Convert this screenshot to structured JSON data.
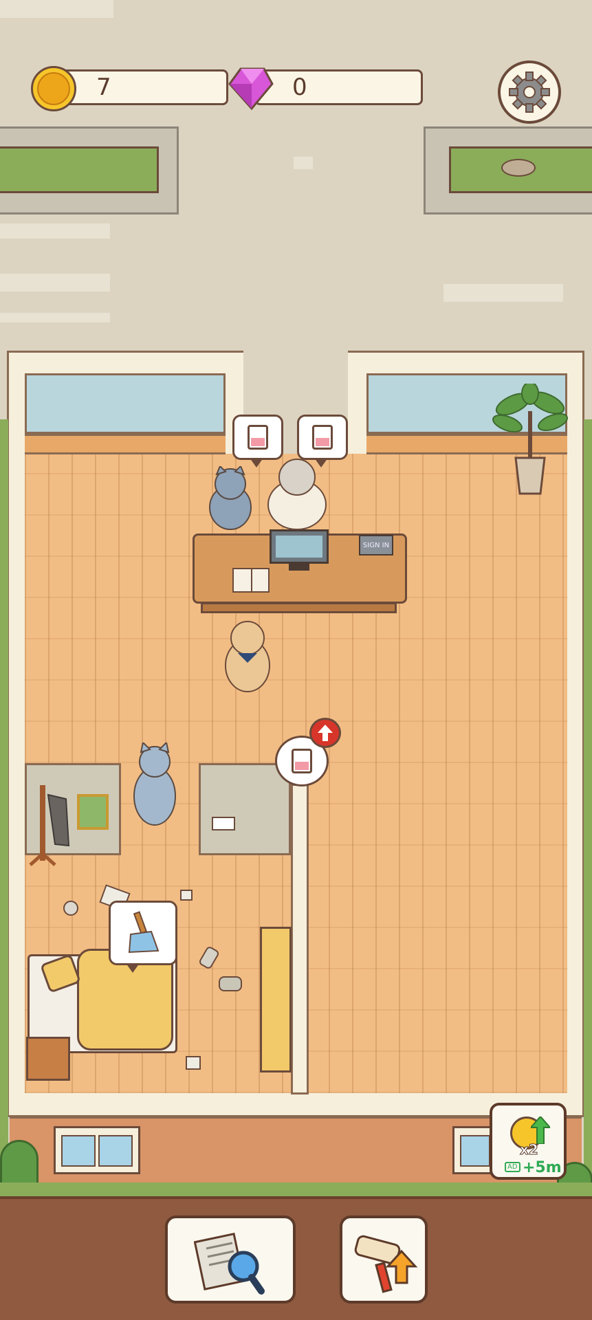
{
  "hud": {
    "coins": "7",
    "gems": "0"
  },
  "reception": {
    "sign": "SIGN IN"
  },
  "boost": {
    "multiplier": "x2",
    "duration": "+5m",
    "ad_label": "AD"
  },
  "icons": {
    "coin": "cat-coin-icon",
    "gem": "gem-icon",
    "settings": "gear-icon",
    "bed": "bed-icon",
    "upgrade": "upgrade-arrow-icon",
    "clean": "broom-icon",
    "search": "newspaper-magnifier-icon",
    "renovate": "paint-roller-icon"
  },
  "colors": {
    "floor": "#f2bd84",
    "outline": "#6b4a3a",
    "bottom_bar": "#8f5a3f",
    "coin": "#f6c52a",
    "gem": "#d856d8",
    "upgrade_badge": "#d8352a"
  }
}
